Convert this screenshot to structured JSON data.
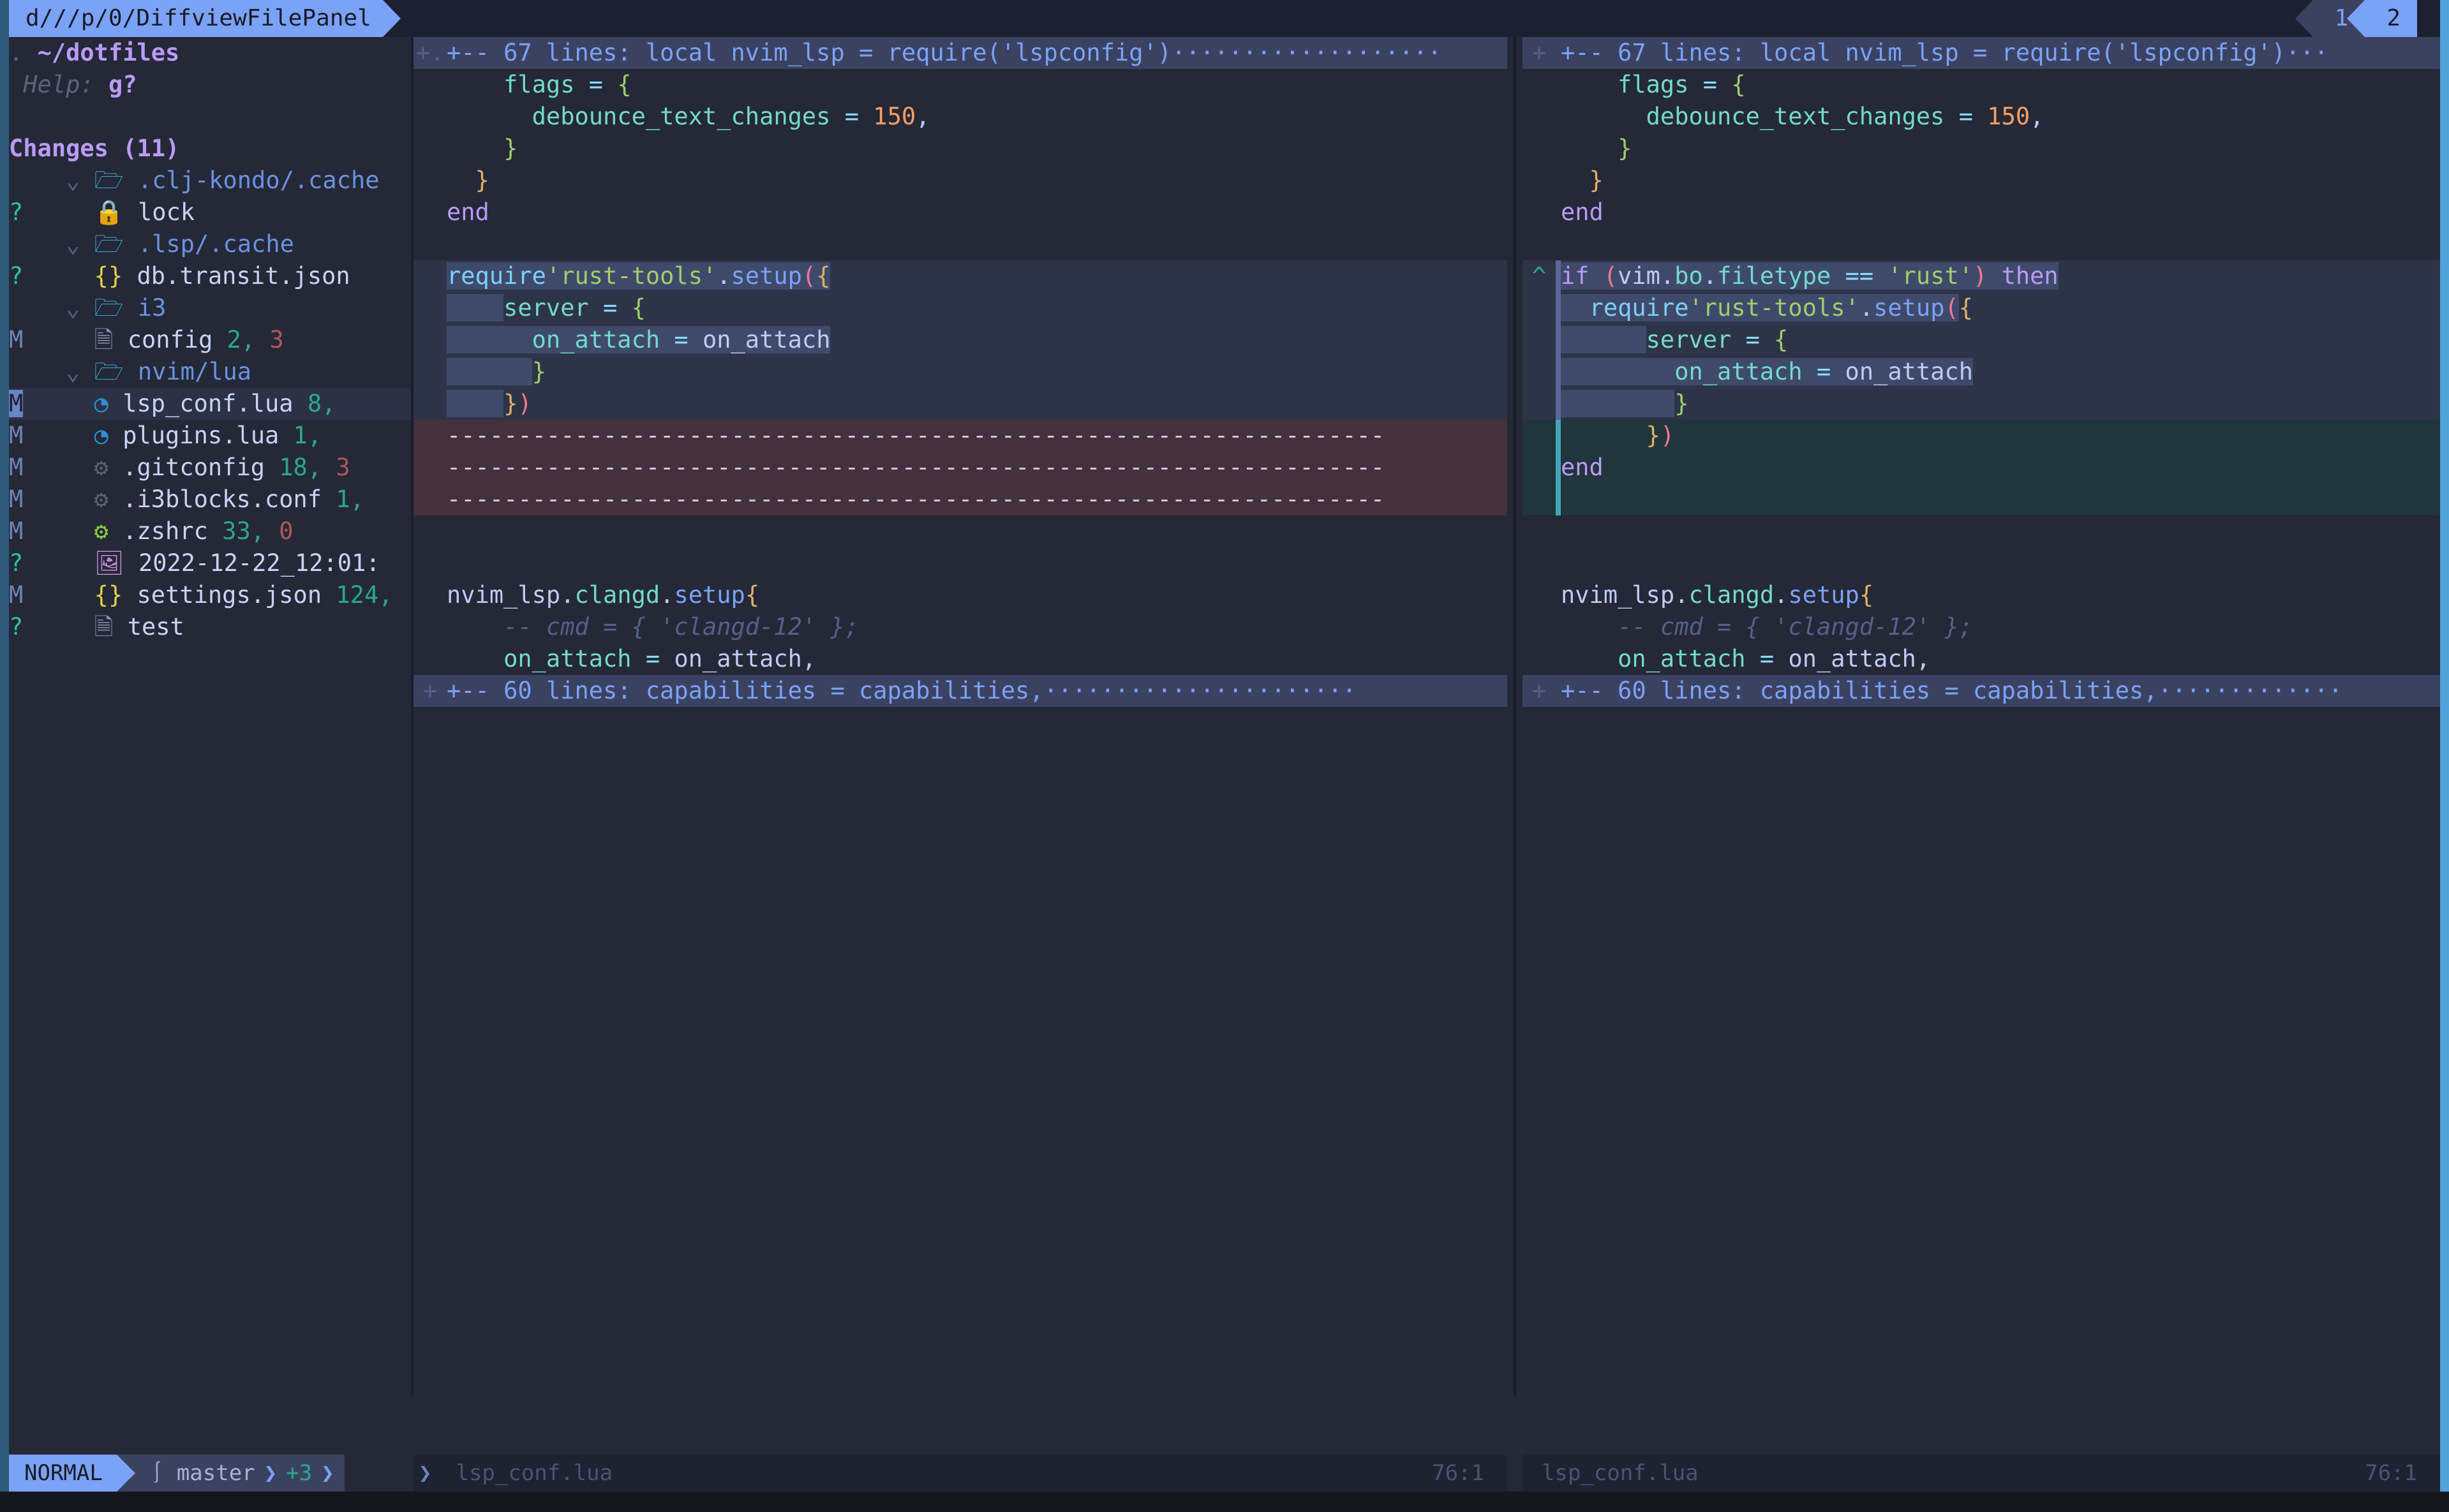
{
  "window": {
    "border_accent": "#2e5a7d",
    "border_right": "#4fa3d9",
    "bg": "#242837"
  },
  "tabline": {
    "active_tab_label": "d///p/0/DiffviewFilePanel",
    "tabs": [
      {
        "number": "1",
        "active": false
      },
      {
        "number": "2",
        "active": true
      }
    ]
  },
  "file_panel": {
    "root_marker": ".",
    "root_path": "~/dotfiles",
    "help_label": "Help:",
    "help_key": "g?",
    "section_title": "Changes (11)",
    "entries": [
      {
        "kind": "dir",
        "status": "",
        "chevron": "⌄",
        "icon": "folder-icon",
        "name": ".clj-kondo/.cache",
        "adds": "",
        "dels": ""
      },
      {
        "kind": "file",
        "status": "?",
        "chevron": "",
        "icon": "lock-icon",
        "name": "lock",
        "adds": "",
        "dels": ""
      },
      {
        "kind": "dir",
        "status": "",
        "chevron": "⌄",
        "icon": "folder-icon",
        "name": ".lsp/.cache",
        "adds": "",
        "dels": ""
      },
      {
        "kind": "file",
        "status": "?",
        "chevron": "",
        "icon": "json-icon",
        "name": "db.transit.json",
        "adds": "",
        "dels": ""
      },
      {
        "kind": "dir",
        "status": "",
        "chevron": "⌄",
        "icon": "folder-icon",
        "name": "i3",
        "adds": "",
        "dels": ""
      },
      {
        "kind": "file",
        "status": "M",
        "chevron": "",
        "icon": "file-icon",
        "name": "config",
        "adds": "2",
        "dels": "3"
      },
      {
        "kind": "dir",
        "status": "",
        "chevron": "⌄",
        "icon": "folder-icon",
        "name": "nvim/lua",
        "adds": "",
        "dels": ""
      },
      {
        "kind": "file",
        "status": "M",
        "chevron": "",
        "icon": "lua-icon",
        "name": "lsp_conf.lua",
        "adds": "8",
        "dels": "",
        "selected": true
      },
      {
        "kind": "file",
        "status": "M",
        "chevron": "",
        "icon": "lua-icon",
        "name": "plugins.lua",
        "adds": "1",
        "dels": ""
      },
      {
        "kind": "file",
        "status": "M",
        "chevron": "",
        "icon": "gear-dim-icon",
        "name": ".gitconfig",
        "adds": "18",
        "dels": "3"
      },
      {
        "kind": "file",
        "status": "M",
        "chevron": "",
        "icon": "gear-dim-icon",
        "name": ".i3blocks.conf",
        "adds": "1",
        "dels": ""
      },
      {
        "kind": "file",
        "status": "M",
        "chevron": "",
        "icon": "gear-green-icon",
        "name": ".zshrc",
        "adds": "33",
        "dels": "0"
      },
      {
        "kind": "file",
        "status": "?",
        "chevron": "",
        "icon": "image-icon",
        "name": "2022-12-22_12:01:",
        "adds": "",
        "dels": ""
      },
      {
        "kind": "file",
        "status": "M",
        "chevron": "",
        "icon": "json-icon",
        "name": "settings.json",
        "adds": "124",
        "dels": ""
      },
      {
        "kind": "file",
        "status": "?",
        "chevron": "",
        "icon": "file-icon",
        "name": "test",
        "adds": "",
        "dels": ""
      }
    ]
  },
  "diff": {
    "left_pane": {
      "filename": "lsp_conf.lua",
      "cursor_pos": "76:1",
      "lines": [
        {
          "sign": "+.",
          "bg": "fold",
          "segments": [
            {
              "t": "+-- 67 lines: local nvim_lsp = require('lspconfig')···················",
              "c": "fold-txt"
            }
          ]
        },
        {
          "sign": "",
          "bg": "",
          "segments": [
            {
              "t": "    flags ",
              "c": "field"
            },
            {
              "t": "= ",
              "c": "op"
            },
            {
              "t": "{",
              "c": "par3"
            }
          ]
        },
        {
          "sign": "",
          "bg": "",
          "segments": [
            {
              "t": "      debounce_text_changes ",
              "c": "field"
            },
            {
              "t": "= ",
              "c": "op"
            },
            {
              "t": "150",
              "c": "num"
            },
            {
              "t": ",",
              "c": "var"
            }
          ]
        },
        {
          "sign": "",
          "bg": "",
          "segments": [
            {
              "t": "    }",
              "c": "par3"
            }
          ]
        },
        {
          "sign": "",
          "bg": "",
          "segments": [
            {
              "t": "  }",
              "c": "par2"
            }
          ]
        },
        {
          "sign": "",
          "bg": "",
          "segments": [
            {
              "t": "end",
              "c": "kw"
            }
          ]
        },
        {
          "sign": "",
          "bg": "",
          "segments": []
        },
        {
          "sign": "",
          "bg": "change",
          "segments": [
            {
              "t": "require",
              "c": "ident",
              "hl": true
            },
            {
              "t": "'rust-tools'",
              "c": "str",
              "hl": true
            },
            {
              "t": ".",
              "c": "var",
              "hl": true
            },
            {
              "t": "setup",
              "c": "fn",
              "hl": true
            },
            {
              "t": "(",
              "c": "par1",
              "hl": true
            },
            {
              "t": "{",
              "c": "par2",
              "hl": true
            }
          ]
        },
        {
          "sign": "",
          "bg": "change",
          "segments": [
            {
              "t": "    ",
              "c": "var",
              "hl": true
            },
            {
              "t": "server ",
              "c": "field"
            },
            {
              "t": "= ",
              "c": "op"
            },
            {
              "t": "{",
              "c": "par3"
            }
          ]
        },
        {
          "sign": "",
          "bg": "change",
          "segments": [
            {
              "t": "      ",
              "c": "var",
              "hl": true
            },
            {
              "t": "on_attach ",
              "c": "field",
              "hl": true
            },
            {
              "t": "= ",
              "c": "op",
              "hl": true
            },
            {
              "t": "on_attach",
              "c": "var",
              "hl": true
            }
          ]
        },
        {
          "sign": "",
          "bg": "change",
          "segments": [
            {
              "t": "      ",
              "c": "var",
              "hl": true
            },
            {
              "t": "}",
              "c": "par3"
            }
          ]
        },
        {
          "sign": "",
          "bg": "change",
          "segments": [
            {
              "t": "    ",
              "c": "var",
              "hl": true
            },
            {
              "t": "}",
              "c": "par2"
            },
            {
              "t": ")",
              "c": "par1"
            }
          ]
        },
        {
          "sign": "",
          "bg": "delln",
          "segments": [
            {
              "t": "------------------------------------------------------------------",
              "c": "del-dash"
            }
          ]
        },
        {
          "sign": "",
          "bg": "delln",
          "segments": [
            {
              "t": "------------------------------------------------------------------",
              "c": "del-dash"
            }
          ]
        },
        {
          "sign": "",
          "bg": "delln",
          "segments": [
            {
              "t": "------------------------------------------------------------------",
              "c": "del-dash"
            }
          ]
        },
        {
          "sign": "",
          "bg": "",
          "segments": []
        },
        {
          "sign": "",
          "bg": "",
          "segments": []
        },
        {
          "sign": "",
          "bg": "",
          "segments": [
            {
              "t": "nvim_lsp",
              "c": "var"
            },
            {
              "t": ".",
              "c": "var"
            },
            {
              "t": "clangd",
              "c": "field"
            },
            {
              "t": ".",
              "c": "var"
            },
            {
              "t": "setup",
              "c": "fn"
            },
            {
              "t": "{",
              "c": "par2"
            }
          ]
        },
        {
          "sign": "",
          "bg": "",
          "segments": [
            {
              "t": "    -- cmd = { 'clangd-12' };",
              "c": "cmt"
            }
          ]
        },
        {
          "sign": "",
          "bg": "",
          "segments": [
            {
              "t": "    on_attach ",
              "c": "field"
            },
            {
              "t": "= ",
              "c": "op"
            },
            {
              "t": "on_attach,",
              "c": "var"
            }
          ]
        },
        {
          "sign": "+",
          "bg": "fold",
          "segments": [
            {
              "t": "+-- 60 lines: capabilities = capabilities,······················",
              "c": "fold-txt"
            }
          ]
        }
      ]
    },
    "right_pane": {
      "filename": "lsp_conf.lua",
      "cursor_pos": "76:1",
      "lines": [
        {
          "sign": "+",
          "bg": "fold",
          "segments": [
            {
              "t": "+-- 67 lines: local nvim_lsp = require('lspconfig')···",
              "c": "fold-txt"
            }
          ]
        },
        {
          "sign": "",
          "bg": "",
          "segments": [
            {
              "t": "    flags ",
              "c": "field"
            },
            {
              "t": "= ",
              "c": "op"
            },
            {
              "t": "{",
              "c": "par3"
            }
          ]
        },
        {
          "sign": "",
          "bg": "",
          "segments": [
            {
              "t": "      debounce_text_changes ",
              "c": "field"
            },
            {
              "t": "= ",
              "c": "op"
            },
            {
              "t": "150",
              "c": "num"
            },
            {
              "t": ",",
              "c": "var"
            }
          ]
        },
        {
          "sign": "",
          "bg": "",
          "segments": [
            {
              "t": "    }",
              "c": "par3"
            }
          ]
        },
        {
          "sign": "",
          "bg": "",
          "segments": [
            {
              "t": "  }",
              "c": "par2"
            }
          ]
        },
        {
          "sign": "",
          "bg": "",
          "segments": [
            {
              "t": "end",
              "c": "kw"
            }
          ]
        },
        {
          "sign": "",
          "bg": "",
          "segments": []
        },
        {
          "sign": "^",
          "bg": "change",
          "segments": [
            {
              "t": "if ",
              "c": "kw",
              "hl": true
            },
            {
              "t": "(",
              "c": "par1",
              "hl": true
            },
            {
              "t": "vim",
              "c": "var",
              "hl": true
            },
            {
              "t": ".",
              "c": "var",
              "hl": true
            },
            {
              "t": "bo",
              "c": "field",
              "hl": true
            },
            {
              "t": ".",
              "c": "var",
              "hl": true
            },
            {
              "t": "filetype ",
              "c": "field",
              "hl": true
            },
            {
              "t": "== ",
              "c": "op",
              "hl": true
            },
            {
              "t": "'rust'",
              "c": "str",
              "hl": true
            },
            {
              "t": ")",
              "c": "par1",
              "hl": true
            },
            {
              "t": " then",
              "c": "kw",
              "hl": true
            }
          ]
        },
        {
          "sign": "",
          "bg": "change",
          "segments": [
            {
              "t": "  ",
              "c": "var",
              "hl": true
            },
            {
              "t": "require",
              "c": "ident",
              "hl": true
            },
            {
              "t": "'rust-tools'",
              "c": "str",
              "hl": true
            },
            {
              "t": ".",
              "c": "var",
              "hl": true
            },
            {
              "t": "setup",
              "c": "fn",
              "hl": true
            },
            {
              "t": "(",
              "c": "par1",
              "hl": true
            },
            {
              "t": "{",
              "c": "par2"
            }
          ]
        },
        {
          "sign": "",
          "bg": "change",
          "segments": [
            {
              "t": "      ",
              "c": "var",
              "hl": true
            },
            {
              "t": "server ",
              "c": "field"
            },
            {
              "t": "= ",
              "c": "op"
            },
            {
              "t": "{",
              "c": "par3"
            }
          ]
        },
        {
          "sign": "",
          "bg": "change",
          "segments": [
            {
              "t": "        ",
              "c": "var",
              "hl": true
            },
            {
              "t": "on_attach ",
              "c": "field",
              "hl": true
            },
            {
              "t": "= ",
              "c": "op",
              "hl": true
            },
            {
              "t": "on_attach",
              "c": "var",
              "hl": true
            }
          ]
        },
        {
          "sign": "",
          "bg": "change",
          "segments": [
            {
              "t": "        ",
              "c": "var",
              "hl": true
            },
            {
              "t": "}",
              "c": "par3"
            }
          ]
        },
        {
          "sign": "",
          "bg": "addln",
          "segments": [
            {
              "t": "      }",
              "c": "par2"
            },
            {
              "t": ")",
              "c": "par1"
            }
          ]
        },
        {
          "sign": "",
          "bg": "addln",
          "segments": [
            {
              "t": "end",
              "c": "kw"
            }
          ]
        },
        {
          "sign": "",
          "bg": "addln",
          "segments": []
        },
        {
          "sign": "",
          "bg": "",
          "segments": []
        },
        {
          "sign": "",
          "bg": "",
          "segments": []
        },
        {
          "sign": "",
          "bg": "",
          "segments": [
            {
              "t": "nvim_lsp",
              "c": "var"
            },
            {
              "t": ".",
              "c": "var"
            },
            {
              "t": "clangd",
              "c": "field"
            },
            {
              "t": ".",
              "c": "var"
            },
            {
              "t": "setup",
              "c": "fn"
            },
            {
              "t": "{",
              "c": "par2"
            }
          ]
        },
        {
          "sign": "",
          "bg": "",
          "segments": [
            {
              "t": "    -- cmd = { 'clangd-12' };",
              "c": "cmt"
            }
          ]
        },
        {
          "sign": "",
          "bg": "",
          "segments": [
            {
              "t": "    on_attach ",
              "c": "field"
            },
            {
              "t": "= ",
              "c": "op"
            },
            {
              "t": "on_attach,",
              "c": "var"
            }
          ]
        },
        {
          "sign": "+",
          "bg": "fold",
          "segments": [
            {
              "t": "+-- 60 lines: capabilities = capabilities,·············",
              "c": "fold-txt"
            }
          ]
        }
      ]
    }
  },
  "statusline": {
    "mode": "NORMAL",
    "branch_icon": "git-branch-icon",
    "branch": "master",
    "diff_added": "+3",
    "left_filename": "lsp_conf.lua",
    "left_pos": "76:1",
    "right_filename": "lsp_conf.lua",
    "right_pos": "76:1"
  }
}
